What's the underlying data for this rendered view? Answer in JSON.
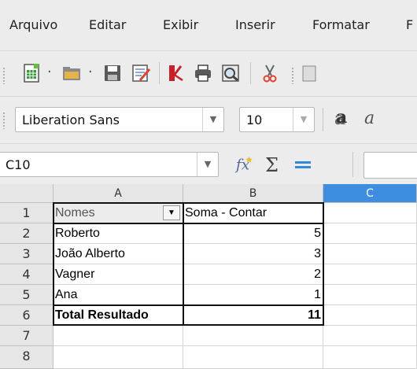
{
  "menu": [
    {
      "label": "Arquivo"
    },
    {
      "label": "Editar"
    },
    {
      "label": "Exibir"
    },
    {
      "label": "Inserir"
    },
    {
      "label": "Formatar"
    },
    {
      "label": "F"
    }
  ],
  "font_name": {
    "value": "Liberation Sans"
  },
  "font_size": {
    "value": "10"
  },
  "name_box": {
    "value": "C10"
  },
  "columns": [
    "A",
    "B",
    "C"
  ],
  "rows": [
    "1",
    "2",
    "3",
    "4",
    "5",
    "6",
    "7",
    "8"
  ],
  "pivot": {
    "field_label": "Nomes",
    "data_label": "Soma - Contar",
    "records": [
      {
        "name": "Roberto",
        "value": "5"
      },
      {
        "name": "João Alberto",
        "value": "3"
      },
      {
        "name": "Vagner",
        "value": "2"
      },
      {
        "name": "Ana",
        "value": "1"
      }
    ],
    "total_label": "Total Resultado",
    "total_value": "11"
  },
  "colors": {
    "accent": "#3d8ee0",
    "selected_col": "#3d8ee0"
  },
  "icons": [
    "new-document-icon",
    "open-folder-icon",
    "save-icon",
    "edit-document-icon",
    "export-pdf-icon",
    "print-icon",
    "print-preview-icon",
    "cut-icon",
    "function-wizard-icon",
    "sum-icon",
    "formula-icon",
    "shadow-text-icon",
    "italic-icon"
  ]
}
